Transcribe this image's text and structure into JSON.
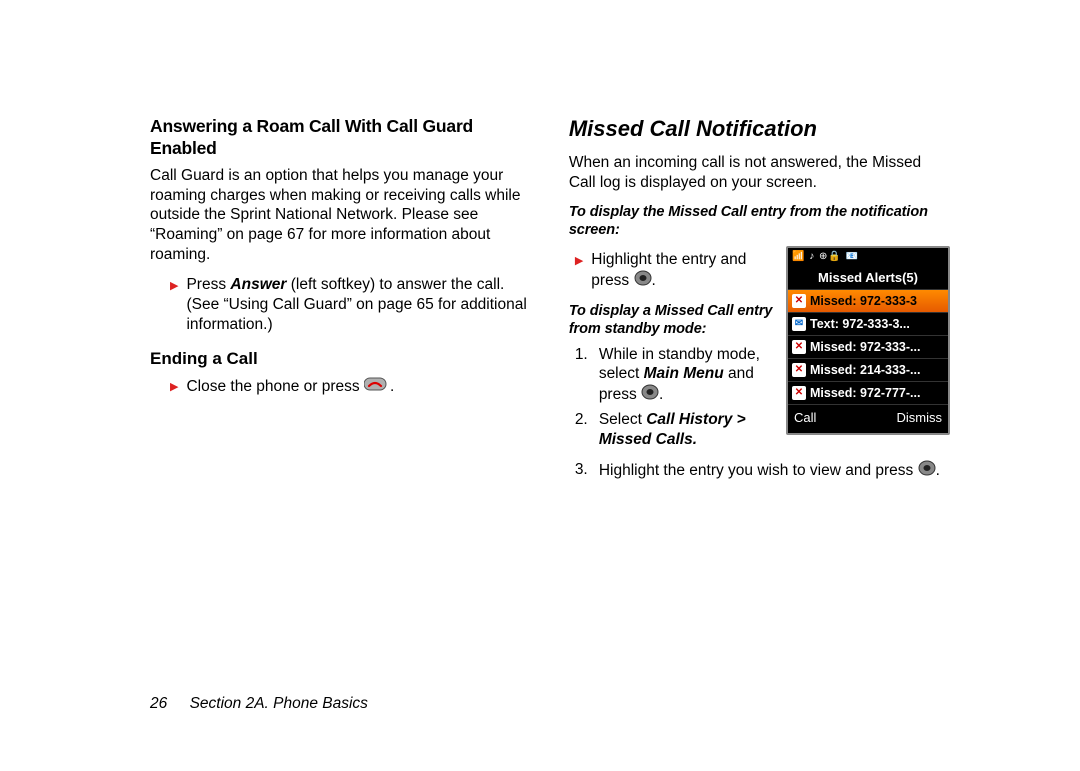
{
  "left": {
    "h1": "Answering a Roam Call With Call Guard Enabled",
    "p1": "Call Guard is an option that helps you manage your roaming charges when making or receiving calls while outside the Sprint National Network. Please see “Roaming” on page 67 for more information about roaming.",
    "b1_pre": "Press ",
    "b1_bold": "Answer",
    "b1_post": " (left softkey) to answer the call. (See “Using Call Guard” on page 65 for additional information.)",
    "h2": "Ending a Call",
    "b2_pre": "Close the phone or press ",
    "b2_post": "."
  },
  "right": {
    "h1": "Missed Call Notification",
    "p1": "When an incoming call is not answered, the Missed Call log is displayed on your screen.",
    "lead1": "To display the Missed Call entry from the notification screen:",
    "b1_pre": "Highlight the entry and press ",
    "b1_post": ".",
    "lead2": "To display a Missed Call entry from standby mode:",
    "s1_pre": "While in standby mode, select ",
    "s1_em": "Main Menu",
    "s1_mid": " and press ",
    "s1_post": ".",
    "s2_pre": "Select ",
    "s2_em": "Call History > Missed Calls",
    "s2_post": ".",
    "s3_pre": "Highlight the entry you wish to view and press ",
    "s3_post": "."
  },
  "screen": {
    "status": "📶  ♪  ⊕🔒 📧",
    "title": "Missed Alerts(5)",
    "rows": [
      {
        "icon": "missed",
        "label": "Missed: 972-333-3"
      },
      {
        "icon": "text",
        "label": "Text: 972-333-3..."
      },
      {
        "icon": "missed",
        "label": "Missed: 972-333-..."
      },
      {
        "icon": "missed",
        "label": "Missed: 214-333-..."
      },
      {
        "icon": "missed",
        "label": "Missed: 972-777-..."
      }
    ],
    "soft_left": "Call",
    "soft_right": "Dismiss"
  },
  "footer": {
    "page": "26",
    "section": "Section 2A. Phone Basics"
  }
}
